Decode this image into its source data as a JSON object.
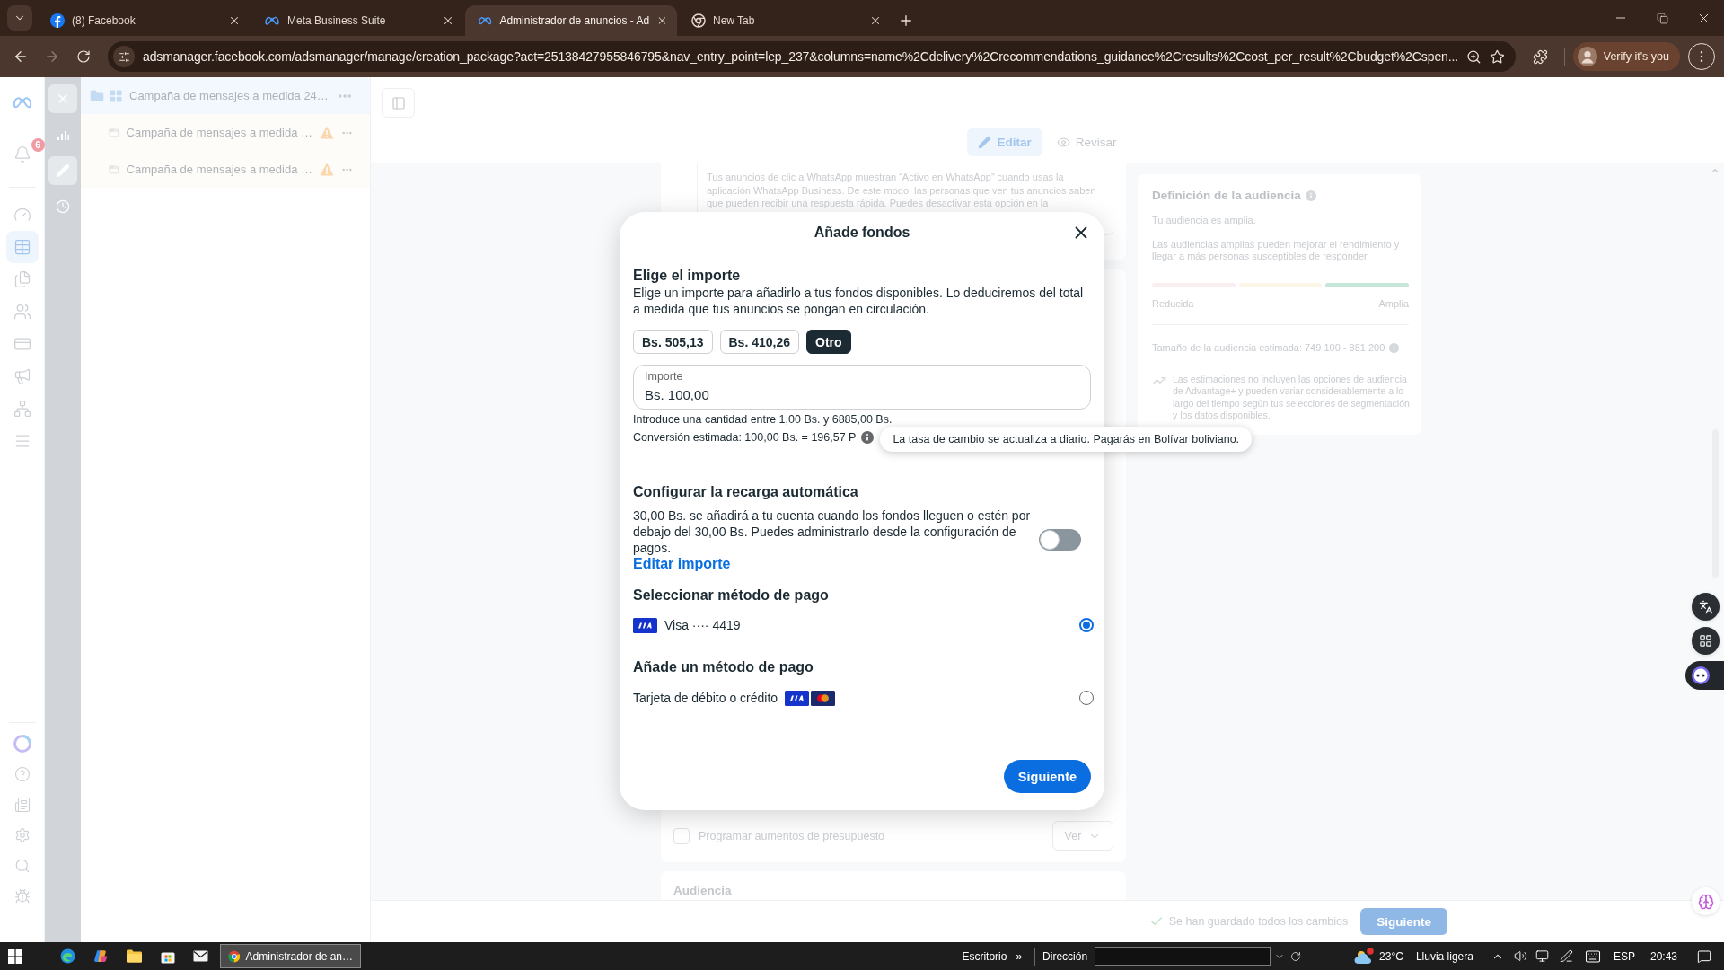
{
  "browser": {
    "tabs": [
      {
        "title": "(8) Facebook",
        "selected": false
      },
      {
        "title": "Meta Business Suite",
        "selected": false
      },
      {
        "title": "Administrador de anuncios - Ad",
        "selected": true
      },
      {
        "title": "New Tab",
        "selected": false
      }
    ],
    "url": "adsmanager.facebook.com/adsmanager/manage/creation_package?act=25138427955846795&nav_entry_point=lep_237&columns=name%2Cdelivery%2Crecommendations_guidance%2Cresults%2Ccost_per_result%2Cbudget%2Cspen...",
    "profile_button": "Verify it's you"
  },
  "nav_rail": {
    "notification_badge": "6",
    "items": [
      {
        "selected": false
      },
      {
        "selected": true
      },
      {
        "selected": false
      },
      {
        "selected": false
      },
      {
        "selected": false
      },
      {
        "selected": false
      },
      {
        "selected": false
      },
      {
        "selected": false
      }
    ]
  },
  "tools_rail": {
    "items": [
      {
        "selected": false
      },
      {
        "selected": true
      },
      {
        "selected": false
      }
    ]
  },
  "campaign_tree": {
    "campaign": {
      "name": "Campaña de mensajes a medida 24…",
      "selected": true,
      "children": [
        {
          "name": "Campaña de mensajes a medida …",
          "warning": true
        },
        {
          "name": "Campaña de mensajes a medida …",
          "warning": true
        }
      ]
    }
  },
  "editor": {
    "modes": [
      {
        "label": "Editar",
        "selected": true
      },
      {
        "label": "Revisar",
        "selected": false
      }
    ],
    "whatsapp_note": "Tus anuncios de clic a WhatsApp muestran “Activo en WhatsApp” cuando usas la aplicación WhatsApp Business. De este modo, las personas que ven tus anuncios saben que pueden recibir una respuesta rápida. Puedes desactivar esta opción en la",
    "budget_schedule": {
      "label": "Programar aumentos de presupuesto",
      "checked": false,
      "dropdown": "Ver"
    },
    "next_section": "Audiencia"
  },
  "audience_panel": {
    "title": "Definición de la audiencia",
    "status": "Tu audiencia es amplia.",
    "description": "Las audiencias amplias pueden mejorar el rendimiento y llegar a más personas susceptibles de responder.",
    "meter": [
      {
        "on": false
      },
      {
        "on": false
      },
      {
        "on": true
      }
    ],
    "min_label": "Reducida",
    "max_label": "Amplia",
    "size": "Tamaño de la audiencia estimada: 749 100 - 881 200",
    "note": "Las estimaciones no incluyen las opciones de audiencia de Advantage+ y pueden variar considerablemente a lo largo del tiempo según tus selecciones de segmentación y los datos disponibles."
  },
  "footer": {
    "status": "Se han guardado todos los cambios",
    "next_button": "Siguiente"
  },
  "dialog": {
    "title": "Añade fondos",
    "amount_section": {
      "heading": "Elige el importe",
      "description": "Elige un importe para añadirlo a tus fondos disponibles. Lo deduciremos del total a medida que tus anuncios se pongan en circulación.",
      "presets": [
        {
          "label": "Bs. 505,13",
          "selected": false
        },
        {
          "label": "Bs. 410,26",
          "selected": false
        },
        {
          "label": "Otro",
          "selected": true
        }
      ],
      "field": {
        "label": "Importe",
        "value": "Bs. 100,00"
      },
      "hint": "Introduce una cantidad entre 1,00 Bs. y 6885,00 Bs.",
      "conversion": "Conversión estimada: 100,00 Bs. = 196,57 P",
      "tooltip": "La tasa de cambio se actualiza a diario. Pagarás en Bolívar boliviano."
    },
    "auto_reload": {
      "heading": "Configurar la recarga automática",
      "description": "30,00 Bs. se añadirá a tu cuenta cuando los fondos lleguen o estén por debajo del 30,00 Bs. Puedes administrarlo desde la configuración de pagos.",
      "link": "Editar importe",
      "on": false
    },
    "payment": {
      "heading": "Seleccionar método de pago",
      "methods": [
        {
          "label": "Visa ···· 4419",
          "selected": true
        }
      ]
    },
    "add_payment": {
      "heading": "Añade un método de pago",
      "options": [
        {
          "label": "Tarjeta de débito o crédito",
          "selected": false
        }
      ]
    },
    "next_button": "Siguiente"
  },
  "taskbar": {
    "window_button": {
      "label": "Administrador de an…",
      "active": true
    },
    "toolbar_label": "Escritorio",
    "toolbar_overflow": "»",
    "address_label": "Dirección",
    "weather": {
      "temperature": "23°C",
      "condition": "Lluvia ligera"
    },
    "language": "ESP",
    "time": "20:43"
  }
}
